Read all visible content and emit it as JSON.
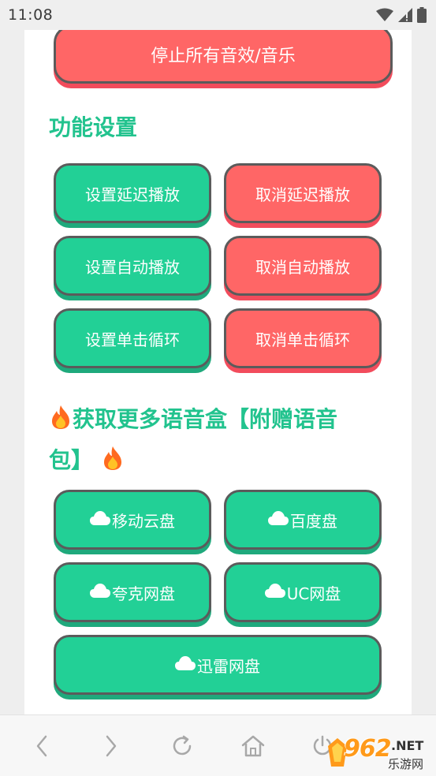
{
  "status_bar": {
    "time": "11:08"
  },
  "top_button": {
    "label": "停止所有音效/音乐"
  },
  "function_section": {
    "title": "功能设置",
    "buttons": [
      {
        "label": "设置延迟播放"
      },
      {
        "label": "取消延迟播放"
      },
      {
        "label": "设置自动播放"
      },
      {
        "label": "取消自动播放"
      },
      {
        "label": "设置单击循环"
      },
      {
        "label": "取消单击循环"
      }
    ]
  },
  "more_section": {
    "title_line1": "获取更多语音盒【附赠语音",
    "title_line2": "包】",
    "buttons": [
      {
        "label": "移动云盘"
      },
      {
        "label": "百度盘"
      },
      {
        "label": "夸克网盘"
      },
      {
        "label": "UC网盘"
      },
      {
        "label": "迅雷网盘"
      }
    ]
  },
  "colors": {
    "accent_green": "#22d096",
    "accent_red": "#ff6666",
    "title_green": "#22c38e"
  },
  "watermark": {
    "brand": "962",
    "suffix": ".NET",
    "sub": "乐游网"
  }
}
